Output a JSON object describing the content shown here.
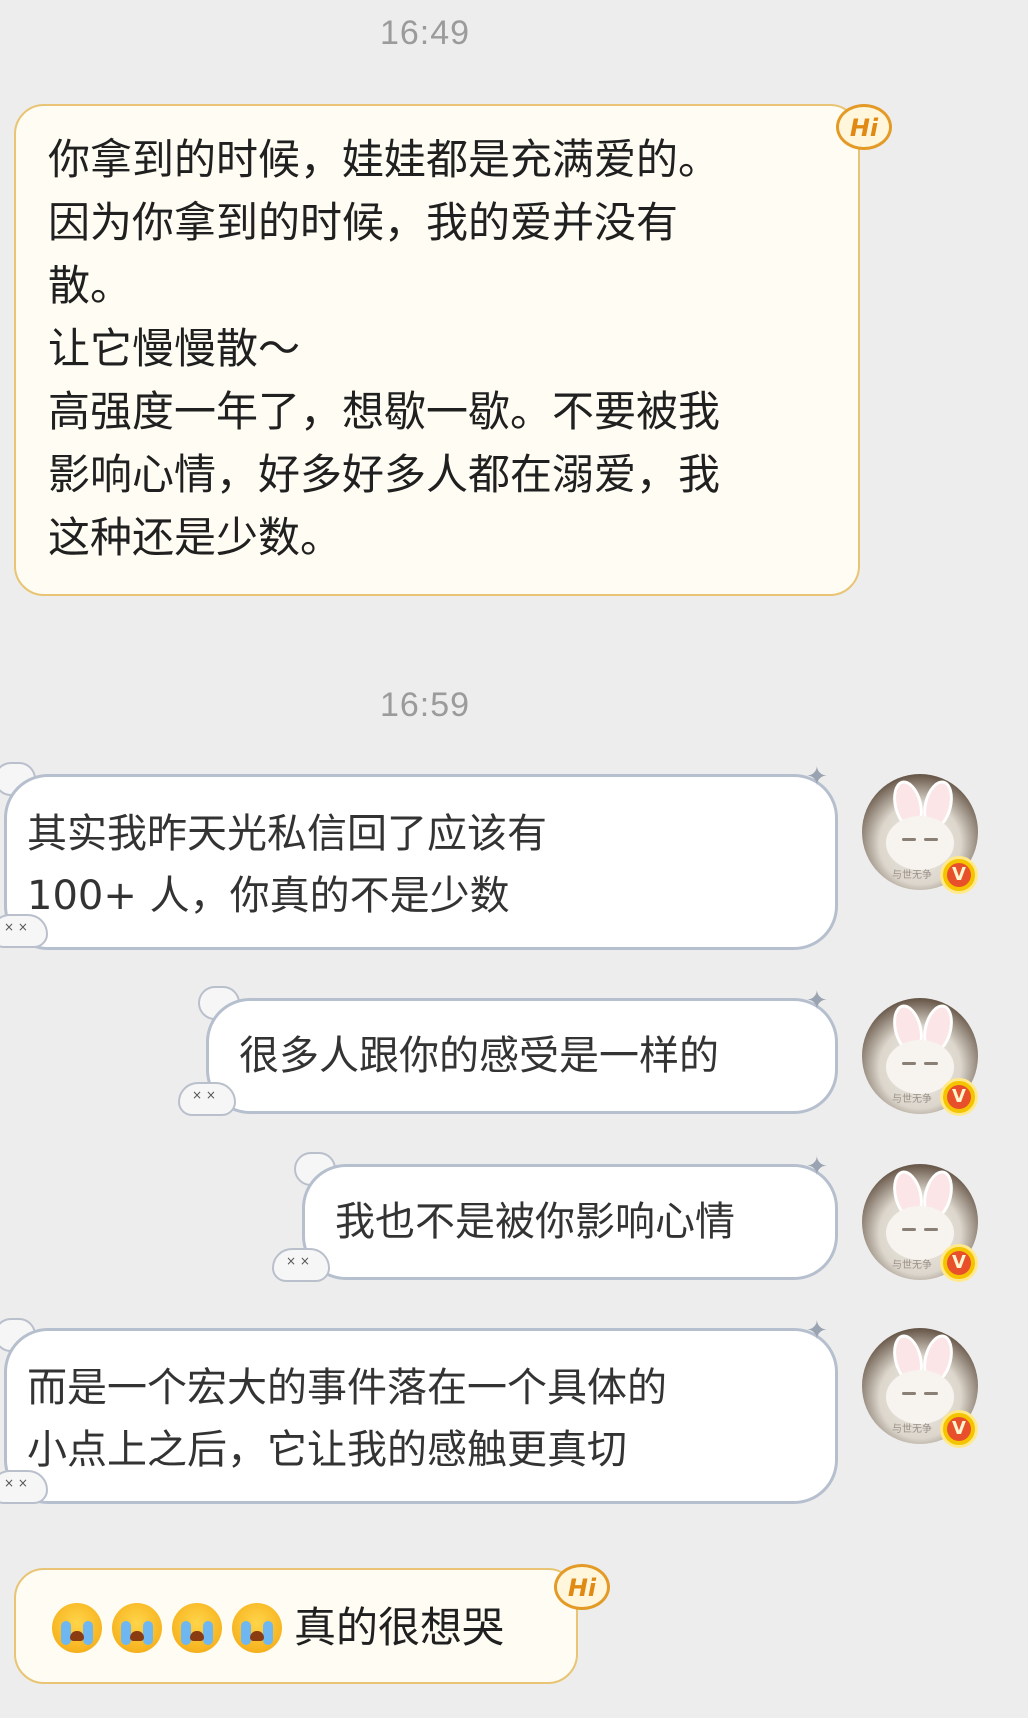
{
  "timestamps": [
    "16:49",
    "16:59"
  ],
  "messages": {
    "m1": "你拿到的时候，娃娃都是充满爱的。\n因为你拿到的时候，我的爱并没有\n散。\n让它慢慢散～\n高强度一年了，想歇一歇。不要被我\n影响心情，好多好多人都在溺爱，我\n这种还是少数。",
    "m2": "其实我昨天光私信回了应该有\n100+ 人，你真的不是少数",
    "m3": "很多人跟你的感受是一样的",
    "m4": "我也不是被你影响心情",
    "m5": "而是一个宏大的事件落在一个具体的\n小点上之后，它让我的感触更真切",
    "m6": "真的很想哭"
  },
  "badges": {
    "hi": "Hi",
    "verified": "V",
    "avatar_watermark": "与世无争"
  },
  "icons": {
    "crying_emoji": "loudly-crying-face",
    "sparkle": "✦"
  },
  "colors": {
    "background": "#ededed",
    "incoming_bubble": "#fffdf3",
    "incoming_border": "#e8c474",
    "outgoing_bubble": "#ffffff",
    "outgoing_border": "#b6bfcd",
    "timestamp": "#9b9b9b"
  }
}
